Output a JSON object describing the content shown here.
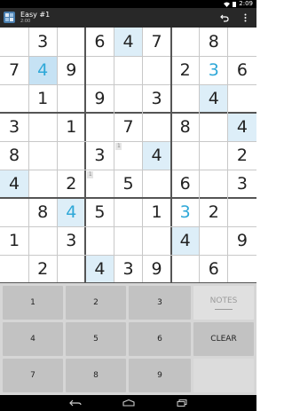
{
  "status": {
    "time": "2:09"
  },
  "app": {
    "title": "Easy #1",
    "subtitle": "2:00"
  },
  "grid": [
    [
      "",
      "3",
      "",
      "6",
      "4",
      "7",
      "",
      "8",
      ""
    ],
    [
      "7",
      "4",
      "9",
      "",
      "",
      "",
      "2",
      "3",
      "6"
    ],
    [
      "",
      "1",
      "",
      "9",
      "",
      "3",
      "",
      "4",
      ""
    ],
    [
      "3",
      "",
      "1",
      "",
      "7",
      "",
      "8",
      "",
      "4"
    ],
    [
      "8",
      "",
      "",
      "3",
      "",
      "4",
      "",
      "",
      "2"
    ],
    [
      "4",
      "",
      "2",
      "",
      "5",
      "",
      "6",
      "",
      "3"
    ],
    [
      "",
      "8",
      "4",
      "5",
      "",
      "1",
      "3",
      "2",
      ""
    ],
    [
      "1",
      "",
      "3",
      "",
      "",
      "",
      "4",
      "",
      "9"
    ],
    [
      "",
      "2",
      "",
      "4",
      "3",
      "9",
      "",
      "6",
      ""
    ]
  ],
  "entered_cells": [
    [
      1,
      1
    ],
    [
      1,
      7
    ],
    [
      6,
      2
    ],
    [
      6,
      6
    ]
  ],
  "highlighted_cells": [
    [
      0,
      4
    ],
    [
      2,
      7
    ],
    [
      3,
      8
    ],
    [
      4,
      5
    ],
    [
      5,
      0
    ],
    [
      6,
      2
    ],
    [
      7,
      6
    ],
    [
      8,
      3
    ],
    [
      1,
      1
    ]
  ],
  "selected_cell": [
    1,
    1
  ],
  "pencil_marks": [
    {
      "row": 4,
      "col": 4,
      "text": "1"
    },
    {
      "row": 5,
      "col": 3,
      "text": "1"
    }
  ],
  "keypad": {
    "keys": [
      "1",
      "2",
      "3",
      "4",
      "5",
      "6",
      "7",
      "8",
      "9"
    ],
    "notes_label": "NOTES",
    "clear_label": "CLEAR"
  },
  "colors": {
    "entered_digit": "#2fa8d8",
    "highlight": "#ddeef8",
    "action_bar": "#282828"
  },
  "icons": {
    "undo": "undo-icon",
    "overflow": "overflow-menu-icon",
    "back": "back-icon",
    "home": "home-icon",
    "recents": "recents-icon"
  }
}
